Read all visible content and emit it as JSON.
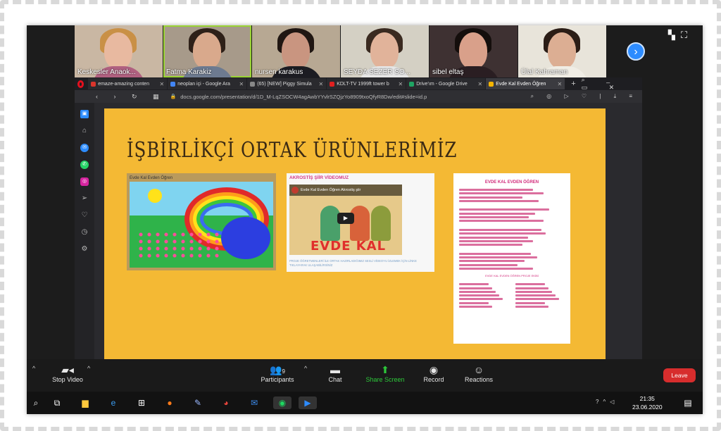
{
  "participants": [
    {
      "name": "Keskesler Anaok...",
      "skin": "#e8b9a0",
      "hair": "#c99046",
      "shirt": "#b06080",
      "bg": "#c9b7a3",
      "active": false
    },
    {
      "name": "Fatma Karakiz",
      "skin": "#d9a98c",
      "hair": "#2e2018",
      "shirt": "#6d7a90",
      "bg": "#a79a8a",
      "active": true
    },
    {
      "name": "nursen karakus",
      "skin": "#c99580",
      "hair": "#201612",
      "shirt": "#1c1c22",
      "bg": "#b7a893",
      "active": false
    },
    {
      "name": "SEYDA SEZER SO...",
      "skin": "#e1b39a",
      "hair": "#3a2a20",
      "shirt": "#e6e6e6",
      "bg": "#d4d0c4",
      "active": false
    },
    {
      "name": "sibel eltaş",
      "skin": "#d9a08a",
      "hair": "#140e0c",
      "shirt": "#2a1e22",
      "bg": "#3e3132",
      "active": false
    },
    {
      "name": "Ülal Kahraman",
      "skin": "#dcae93",
      "hair": "#2b1d16",
      "shirt": "#f0ede5",
      "bg": "#e8e4da",
      "active": false
    }
  ],
  "browser": {
    "tabs": [
      {
        "title": "emaze-amazing conten",
        "color": "#d9352c",
        "active": false
      },
      {
        "title": "neoplan içi - Google Ara",
        "color": "#4285f4",
        "active": false
      },
      {
        "title": "(65) [NEW] Piggy Simula",
        "color": "#888888",
        "active": false
      },
      {
        "title": "KDLT-TV 1999ft tower b",
        "color": "#e02020",
        "active": false
      },
      {
        "title": "Drive'ım - Google Drive",
        "color": "#1fa463",
        "active": false
      },
      {
        "title": "Evde Kal Evden Öğren",
        "color": "#f4b400",
        "active": true
      }
    ],
    "url": "docs.google.com/presentation/d/1D_M-LqZSOCW4agAwbYYvlrSZQjzYo8909txoQfyR8Dw/edit#slide=id.p"
  },
  "slide": {
    "title": "İŞBİRLİKÇİ ORTAK ÜRÜNLERİMİZ",
    "card1_title": "Evde Kal Evden Öğren",
    "card2_title": "AKROSTİŞ ŞİİR VİDEOMUZ",
    "video_title": "Evde Kal Evden Öğren Akrostiş şiir",
    "video_brand": "EVDE KAL",
    "card2_caption": "PROJE ÖĞRETMENLERİ İLE ORTAK HAZIRLADIĞIMIZ SESLİ VİDEOYU İZLEMEK İÇİN LİNKE TIKLAYARAK ULAŞABİLİRSİNİZ",
    "card3_title": "EVDE KAL EVDEN ÖĞREN",
    "card3_footer": "EVDE KAL EVDEN ÖĞREN PROJE EKİBİ"
  },
  "toolbar": {
    "stop_video": "Stop Video",
    "participants": "Participants",
    "participants_count": "9",
    "chat": "Chat",
    "share_screen": "Share Screen",
    "record": "Record",
    "reactions": "Reactions",
    "leave": "Leave"
  },
  "taskbar": {
    "time": "21:35",
    "date": "23.06.2020"
  }
}
